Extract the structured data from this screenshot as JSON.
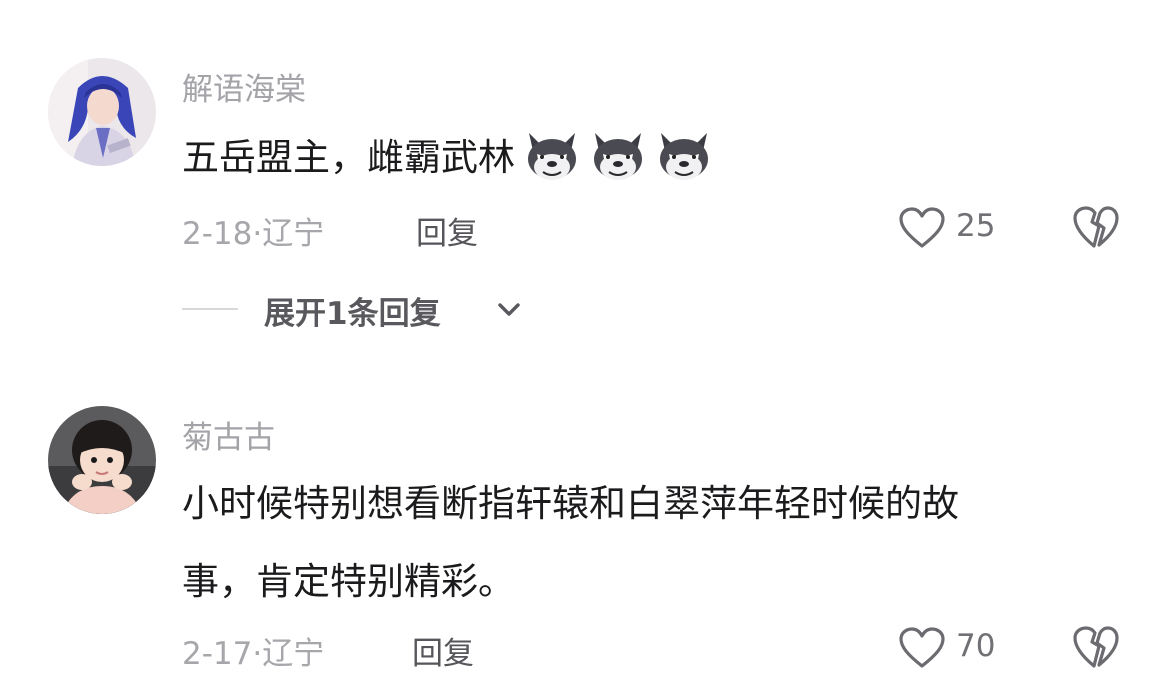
{
  "comments": [
    {
      "username": "解语海棠",
      "text_lines": [
        "五岳盟主，雌霸武林"
      ],
      "emojis": [
        "wolf-face-emoji",
        "wolf-face-emoji",
        "wolf-face-emoji"
      ],
      "date": "2-18",
      "location": "辽宁",
      "reply_label": "回复",
      "like_count": "25",
      "expand_replies": "展开1条回复",
      "avatar": "cosplay-avatar"
    },
    {
      "username": "菊古古",
      "text_lines": [
        "小时候特别想看断指轩辕和白翠萍年轻时候的故",
        "事，肯定特别精彩。"
      ],
      "date": "2-17",
      "location": "辽宁",
      "reply_label": "回复",
      "like_count": "70",
      "avatar": "child-avatar"
    }
  ],
  "meta_separator": "·",
  "icons": {
    "like": "heart-outline-icon",
    "dislike": "broken-heart-icon",
    "expand": "chevron-down-icon"
  },
  "colors": {
    "username": "#a3a3a8",
    "text": "#1b1b1d",
    "meta": "#a6a6ab",
    "icon": "#6b6b70"
  }
}
